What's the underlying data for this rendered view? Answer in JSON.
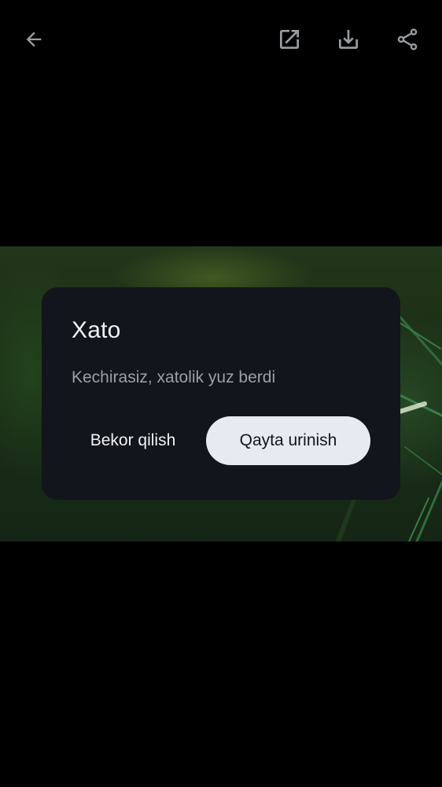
{
  "toolbar": {
    "back_icon": "arrow-back-icon",
    "open_external_icon": "open-in-new-icon",
    "download_icon": "download-icon",
    "share_icon": "share-icon"
  },
  "dialog": {
    "title": "Xato",
    "message": "Kechirasiz, xatolik yuz berdi",
    "cancel_label": "Bekor qilish",
    "retry_label": "Qayta urinish"
  },
  "colors": {
    "background": "#000000",
    "dialog_surface": "#12151b",
    "primary_button": "#e7eaf0",
    "icon": "#9a9da3"
  }
}
